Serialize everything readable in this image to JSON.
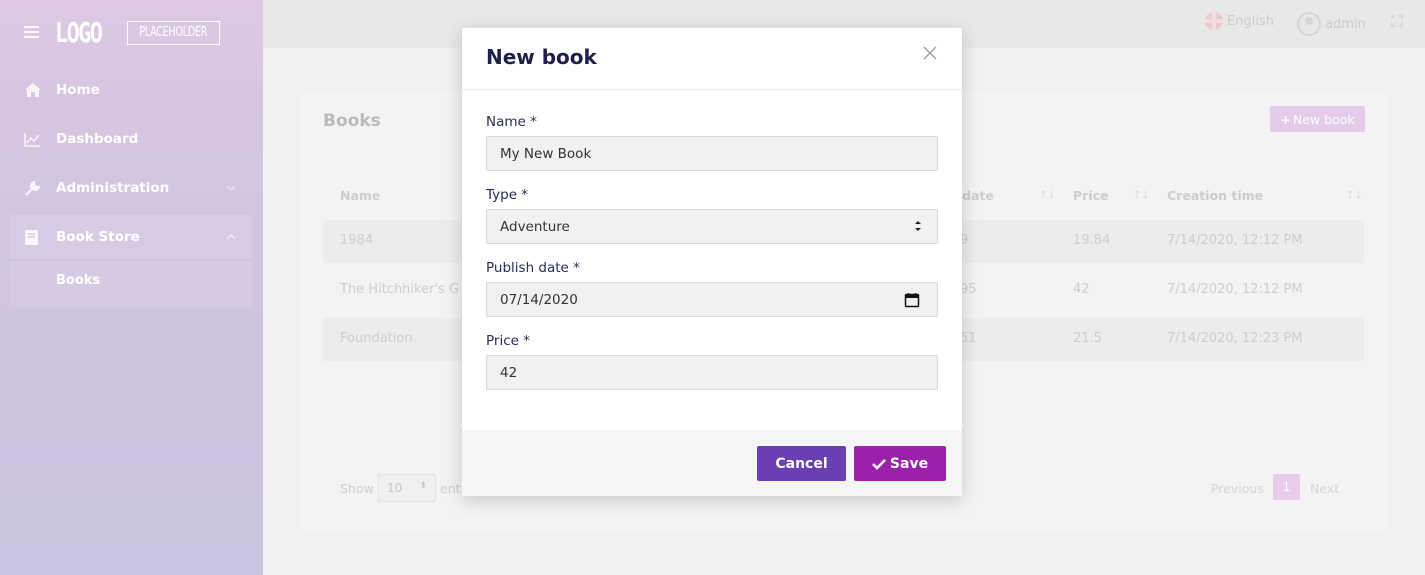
{
  "sidebar": {
    "logo": "LOGO",
    "logo_placeholder": "PLACEHOLDER",
    "items": [
      {
        "label": "Home",
        "icon": "home-icon"
      },
      {
        "label": "Dashboard",
        "icon": "chart-line-icon"
      },
      {
        "label": "Administration",
        "icon": "wrench-icon"
      },
      {
        "label": "Book Store",
        "icon": "book-icon"
      }
    ],
    "submenu": [
      {
        "label": "Books"
      }
    ]
  },
  "topbar": {
    "language": "English",
    "user": "admin"
  },
  "card": {
    "title": "Books",
    "new_book_label": "New book",
    "columns": [
      "Name",
      "date",
      "Price",
      "Creation time"
    ],
    "rows": [
      {
        "name": "1984",
        "date": "9",
        "price": "19.84",
        "created": "7/14/2020, 12:12 PM"
      },
      {
        "name": "The Hitchhiker's G",
        "date": "95",
        "price": "42",
        "created": "7/14/2020, 12:12 PM"
      },
      {
        "name": "Foundation",
        "date": "51",
        "price": "21.5",
        "created": "7/14/2020, 12:23 PM"
      }
    ],
    "show_label": "Show",
    "page_size": "10",
    "entries_label": "ent",
    "previous": "Previous",
    "page": "1",
    "next": "Next"
  },
  "modal": {
    "title": "New book",
    "fields": {
      "name": {
        "label": "Name *",
        "value": "My New Book"
      },
      "type": {
        "label": "Type *",
        "value": "Adventure"
      },
      "publish_date": {
        "label": "Publish date *",
        "value": "07/14/2020"
      },
      "price": {
        "label": "Price *",
        "value": "42"
      }
    },
    "cancel_label": "Cancel",
    "save_label": "Save"
  },
  "colors": {
    "cancel": "#6a3fb5",
    "save": "#9b21ad",
    "title": "#1d1f4d"
  }
}
